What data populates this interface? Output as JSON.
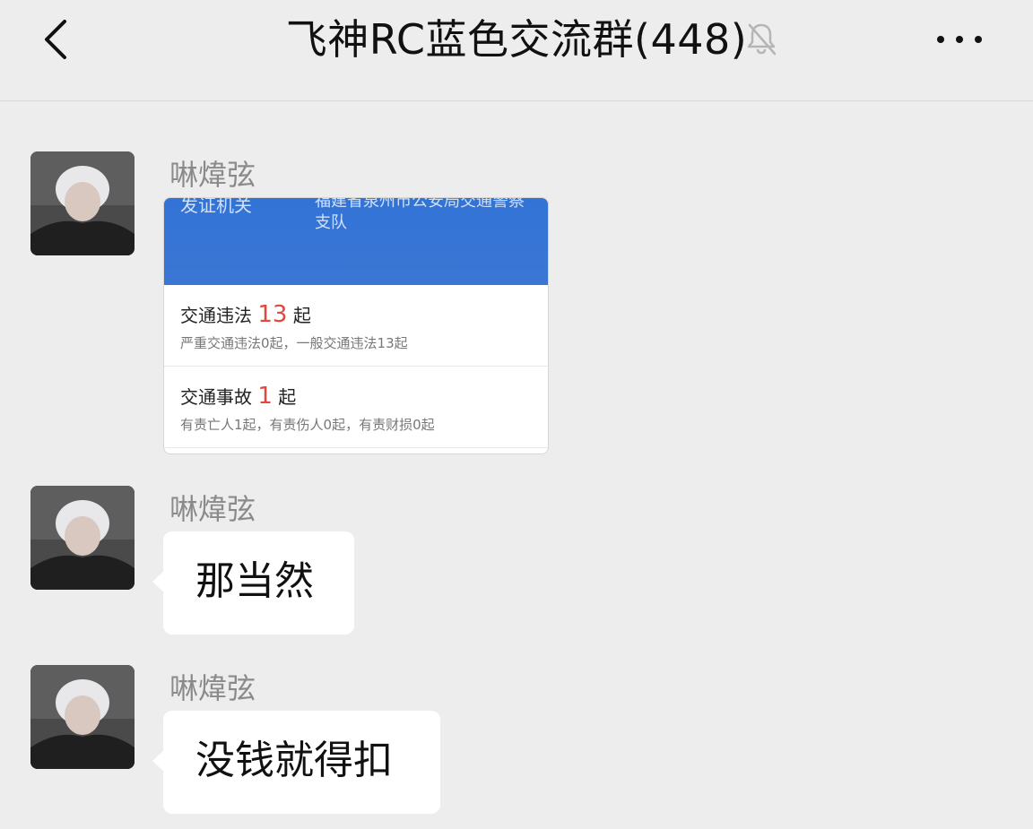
{
  "header": {
    "title": "飞神RC蓝色交流群(448)",
    "icons": {
      "back": "chevron-left-icon",
      "muted": "bell-off-icon",
      "more": "more-dots-icon"
    }
  },
  "messages": [
    {
      "sender": "啉煒弦",
      "type": "image",
      "image": {
        "issuer_label": "发证机关",
        "issuer_value": "福建省泉州市公安局交通警察支队",
        "rows": [
          {
            "label": "交通违法",
            "count": "13",
            "unit": "起",
            "detail": "严重交通违法0起，一般交通违法13起"
          },
          {
            "label": "交通事故",
            "count": "1",
            "unit": "起",
            "detail": "有责亡人1起，有责伤人0起，有责财损0起"
          }
        ]
      }
    },
    {
      "sender": "啉煒弦",
      "type": "text",
      "text": "那当然"
    },
    {
      "sender": "啉煒弦",
      "type": "text",
      "text": "没钱就得扣"
    }
  ],
  "colors": {
    "background": "#ededed",
    "bubble": "#ffffff",
    "accent_blue": "#3273d6",
    "highlight_red": "#e0473f"
  }
}
